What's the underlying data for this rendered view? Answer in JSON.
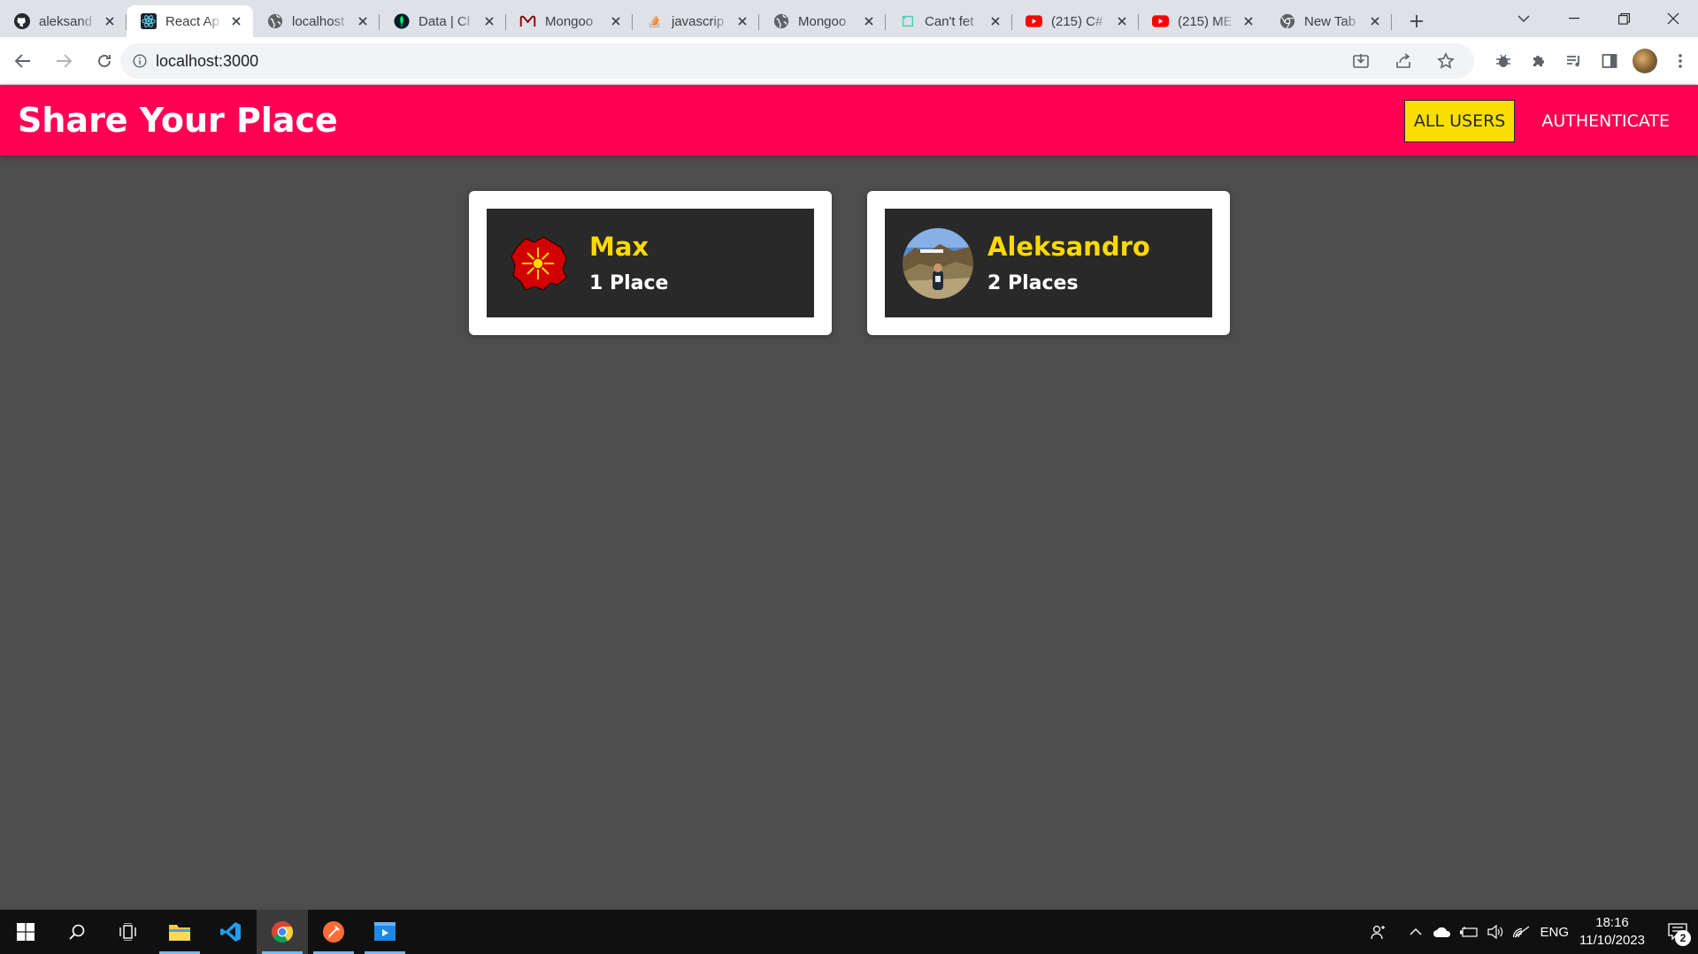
{
  "browser": {
    "tabs": [
      {
        "title": "aleksand",
        "icon": "github-icon"
      },
      {
        "title": "React Ap",
        "icon": "react-icon",
        "active": true
      },
      {
        "title": "localhost",
        "icon": "globe-icon"
      },
      {
        "title": "Data | Cl",
        "icon": "mongodb-leaf-icon"
      },
      {
        "title": "Mongoo",
        "icon": "mongoose-icon"
      },
      {
        "title": "javascrip",
        "icon": "stackoverflow-icon"
      },
      {
        "title": "Mongoo",
        "icon": "globe-icon"
      },
      {
        "title": "Can't fet",
        "icon": "page-icon"
      },
      {
        "title": "(215) C#",
        "icon": "youtube-icon"
      },
      {
        "title": "(215) ME",
        "icon": "youtube-icon"
      },
      {
        "title": "New Tab",
        "icon": "chrome-icon"
      }
    ],
    "url": "localhost:3000"
  },
  "app": {
    "title": "Share Your Place",
    "nav": {
      "all_users": "ALL USERS",
      "authenticate": "AUTHENTICATE"
    }
  },
  "users": [
    {
      "name": "Max",
      "places": "1 Place",
      "avatar": "macedonia-map-avatar"
    },
    {
      "name": "Aleksandro",
      "places": "2 Places",
      "avatar": "hollywood-photo-avatar"
    }
  ],
  "taskbar": {
    "language": "ENG",
    "time": "18:16",
    "date": "11/10/2023",
    "notifications": "2"
  },
  "colors": {
    "header": "#ff0055",
    "active_nav": "#f8df00",
    "card_inner": "#292929",
    "user_name": "#ffd900",
    "page_bg": "#4d4d4d"
  }
}
